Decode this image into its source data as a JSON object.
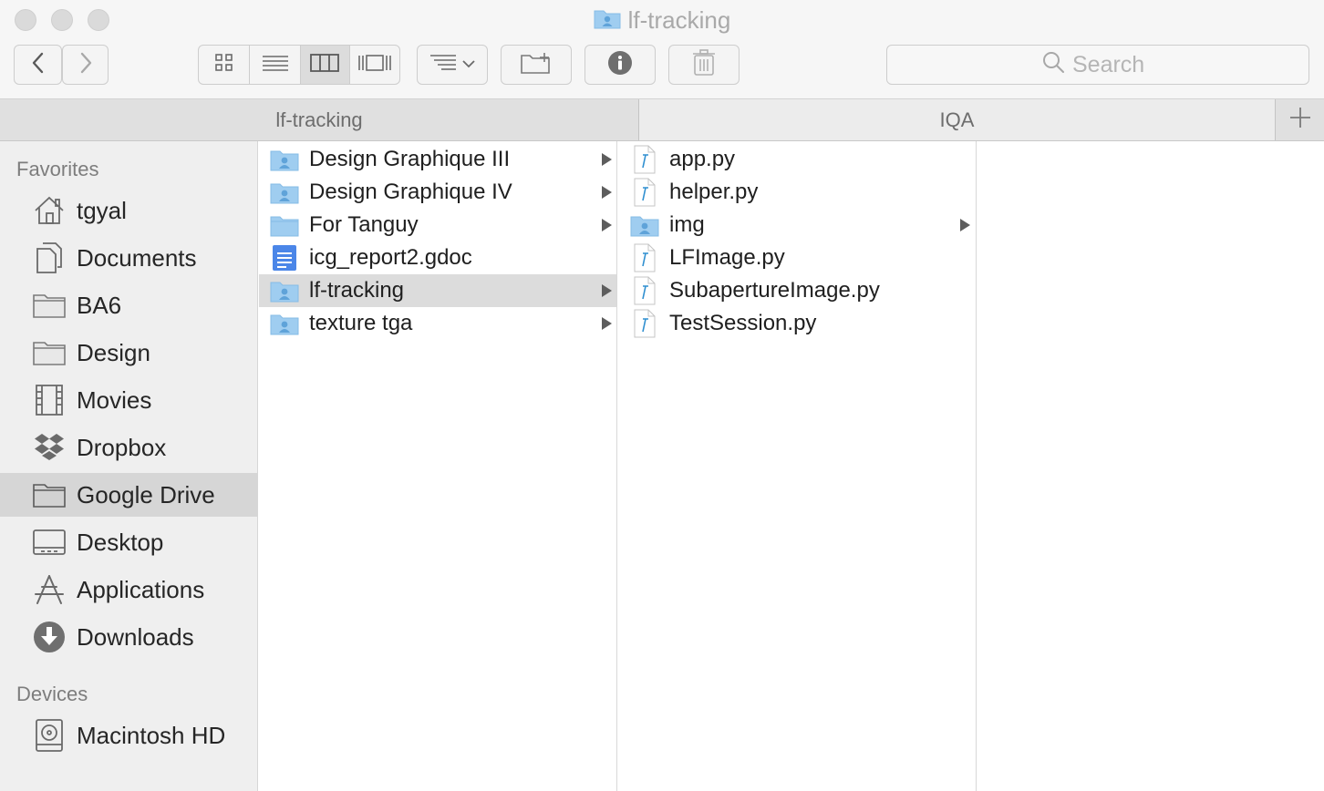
{
  "window": {
    "title": "lf-tracking"
  },
  "toolbar": {
    "back_icon": "chevron-left-icon",
    "forward_icon": "chevron-right-icon",
    "view_modes": [
      "icon-view",
      "list-view",
      "column-view",
      "cover-flow-view"
    ],
    "active_view": "column-view",
    "search_placeholder": "Search"
  },
  "tabs": [
    {
      "label": "lf-tracking",
      "active": false
    },
    {
      "label": "IQA",
      "active": true
    }
  ],
  "sidebar": {
    "favorites_heading": "Favorites",
    "items": [
      {
        "label": "tgyal",
        "icon": "home-icon"
      },
      {
        "label": "Documents",
        "icon": "documents-icon"
      },
      {
        "label": "BA6",
        "icon": "folder-icon"
      },
      {
        "label": "Design",
        "icon": "folder-icon"
      },
      {
        "label": "Movies",
        "icon": "movies-icon"
      },
      {
        "label": "Dropbox",
        "icon": "dropbox-icon"
      },
      {
        "label": "Google Drive",
        "icon": "folder-icon",
        "selected": true
      },
      {
        "label": "Desktop",
        "icon": "desktop-icon"
      },
      {
        "label": "Applications",
        "icon": "applications-icon"
      },
      {
        "label": "Downloads",
        "icon": "downloads-icon"
      }
    ],
    "devices_heading": "Devices",
    "devices": [
      {
        "label": "Macintosh HD",
        "icon": "hard-drive-icon"
      }
    ]
  },
  "columns": [
    {
      "items": [
        {
          "label": "Design Graphique III",
          "icon": "shared-folder-icon",
          "has_children": true
        },
        {
          "label": "Design Graphique IV",
          "icon": "shared-folder-icon",
          "has_children": true
        },
        {
          "label": "For Tanguy",
          "icon": "folder-icon",
          "has_children": true
        },
        {
          "label": "icg_report2.gdoc",
          "icon": "gdoc-icon",
          "has_children": false
        },
        {
          "label": "lf-tracking",
          "icon": "shared-folder-icon",
          "has_children": true,
          "selected": true
        },
        {
          "label": "texture tga",
          "icon": "shared-folder-icon",
          "has_children": true
        }
      ]
    },
    {
      "items": [
        {
          "label": "app.py",
          "icon": "python-file-icon",
          "has_children": false
        },
        {
          "label": "helper.py",
          "icon": "python-file-icon",
          "has_children": false
        },
        {
          "label": "img",
          "icon": "shared-folder-icon",
          "has_children": true
        },
        {
          "label": "LFImage.py",
          "icon": "python-file-icon",
          "has_children": false
        },
        {
          "label": "SubapertureImage.py",
          "icon": "python-file-icon",
          "has_children": false
        },
        {
          "label": "TestSession.py",
          "icon": "python-file-icon",
          "has_children": false
        }
      ]
    }
  ]
}
